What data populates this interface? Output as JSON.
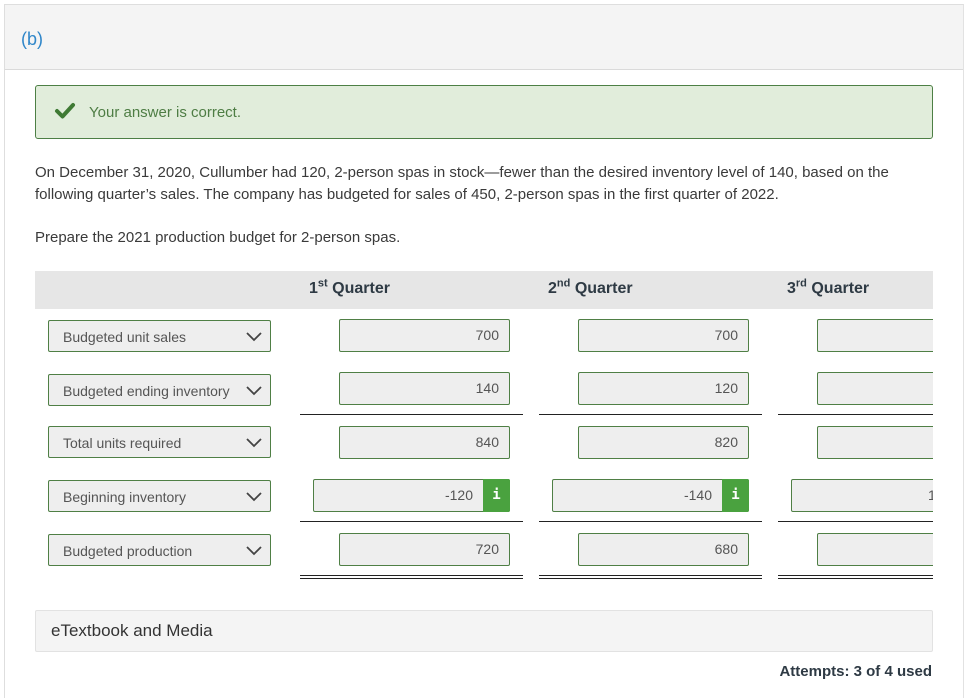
{
  "part": {
    "label": "(b)"
  },
  "feedback": {
    "icon": "checkmark-icon",
    "message": "Your answer is correct.",
    "color": "#4e7d44",
    "background": "#e1eddb"
  },
  "problem": {
    "text": "On December 31, 2020, Cullumber had 120, 2-person spas in stock—fewer than the desired inventory level of 140, based on the following quarter’s sales. The company has budgeted for sales of 450, 2-person spas in the first quarter of 2022.",
    "instruction": "Prepare the 2021 production budget for 2-person spas."
  },
  "table": {
    "columns": [
      {
        "num": "1",
        "suffix": "st",
        "label": "Quarter"
      },
      {
        "num": "2",
        "suffix": "nd",
        "label": "Quarter"
      },
      {
        "num": "3",
        "suffix": "rd",
        "label": "Quarter"
      }
    ],
    "rows": [
      {
        "label": "Budgeted unit sales",
        "values": [
          "700",
          "700",
          ""
        ]
      },
      {
        "label": "Budgeted ending inventory",
        "values": [
          "140",
          "120",
          ""
        ]
      },
      {
        "label": "Total units required",
        "values": [
          "840",
          "820",
          ""
        ]
      },
      {
        "label": "Beginning inventory",
        "values": [
          "-120",
          "-140",
          "1"
        ],
        "info": true
      },
      {
        "label": "Budgeted production",
        "values": [
          "720",
          "680",
          ""
        ]
      }
    ],
    "info_icon": "i"
  },
  "etextbook": {
    "label": "eTextbook and Media"
  },
  "attempts": {
    "label": "Attempts: 3 of 4 used"
  },
  "colors": {
    "accent_blue": "#2f86c9",
    "field_border": "#4f7f45",
    "info_green": "#4aa23f"
  }
}
